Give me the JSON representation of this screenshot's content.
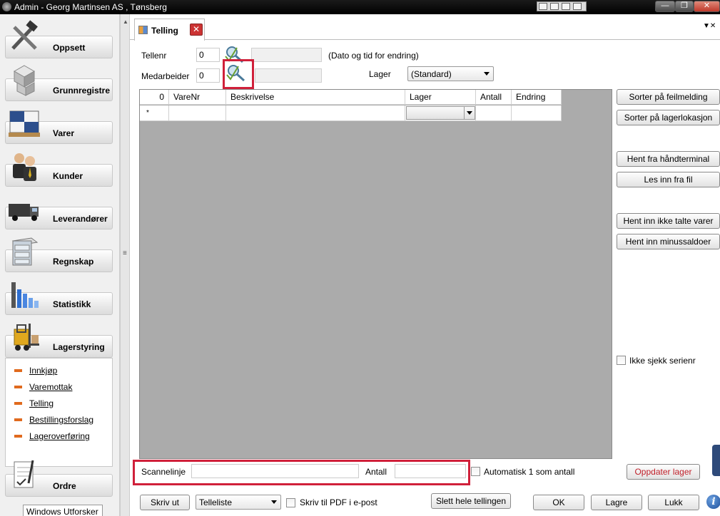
{
  "window": {
    "title": "Admin - Georg Martinsen AS , Tønsberg",
    "controls": {
      "minimize": "—",
      "maximize": "❐",
      "close": "✕"
    }
  },
  "sidebar": {
    "items": [
      {
        "label": "Oppsett",
        "icon": "tools-icon"
      },
      {
        "label": "Grunnregistre",
        "icon": "cubes-icon"
      },
      {
        "label": "Varer",
        "icon": "pallet-icon"
      },
      {
        "label": "Kunder",
        "icon": "people-icon"
      },
      {
        "label": "Leverandører",
        "icon": "truck-icon"
      },
      {
        "label": "Regnskap",
        "icon": "cabinet-icon"
      },
      {
        "label": "Statistikk",
        "icon": "bar-chart-icon"
      },
      {
        "label": "Lagerstyring",
        "icon": "forklift-icon"
      },
      {
        "label": "Ordre",
        "icon": "document-icon"
      }
    ],
    "subitems": [
      "Innkjøp",
      "Varemottak",
      "Telling",
      "Bestillingsforslag",
      "Lageroverføring"
    ],
    "tooltip": "Windows Utforsker"
  },
  "tab": {
    "label": "Telling",
    "close": "✕"
  },
  "form": {
    "tellenr_label": "Tellenr",
    "tellenr_value": "0",
    "medarbeider_label": "Medarbeider",
    "medarbeider_value": "0",
    "date_note": "(Dato og tid for endring)",
    "lager_label": "Lager",
    "lager_value": "(Standard)"
  },
  "grid": {
    "row_count": "0",
    "new_row_marker": "*",
    "columns": [
      "VareNr",
      "Beskrivelse",
      "Lager",
      "Antall",
      "Endring"
    ]
  },
  "side_buttons": {
    "sort_error": "Sorter på feilmelding",
    "sort_location": "Sorter på lagerlokasjon",
    "fetch_terminal": "Hent fra håndterminal",
    "read_file": "Les inn fra fil",
    "fetch_uncounted": "Hent inn ikke talte varer",
    "fetch_negative": "Hent inn minussaldoer",
    "ignore_serial": "Ikke sjekk serienr"
  },
  "scan": {
    "label": "Scannelinje",
    "value": "",
    "antall_label": "Antall",
    "antall_value": "",
    "auto_one": "Automatisk 1 som antall",
    "update_stock": "Oppdater lager"
  },
  "footer": {
    "print": "Skriv ut",
    "list_value": "Telleliste",
    "pdf": "Skriv til PDF i e-post",
    "delete_all": "Slett hele tellingen",
    "ok": "OK",
    "save": "Lagre",
    "close": "Lukk",
    "info": "i"
  },
  "colors": {
    "highlight": "#d0203a",
    "grid_bg": "#ababab",
    "update_text": "#c0202a"
  }
}
